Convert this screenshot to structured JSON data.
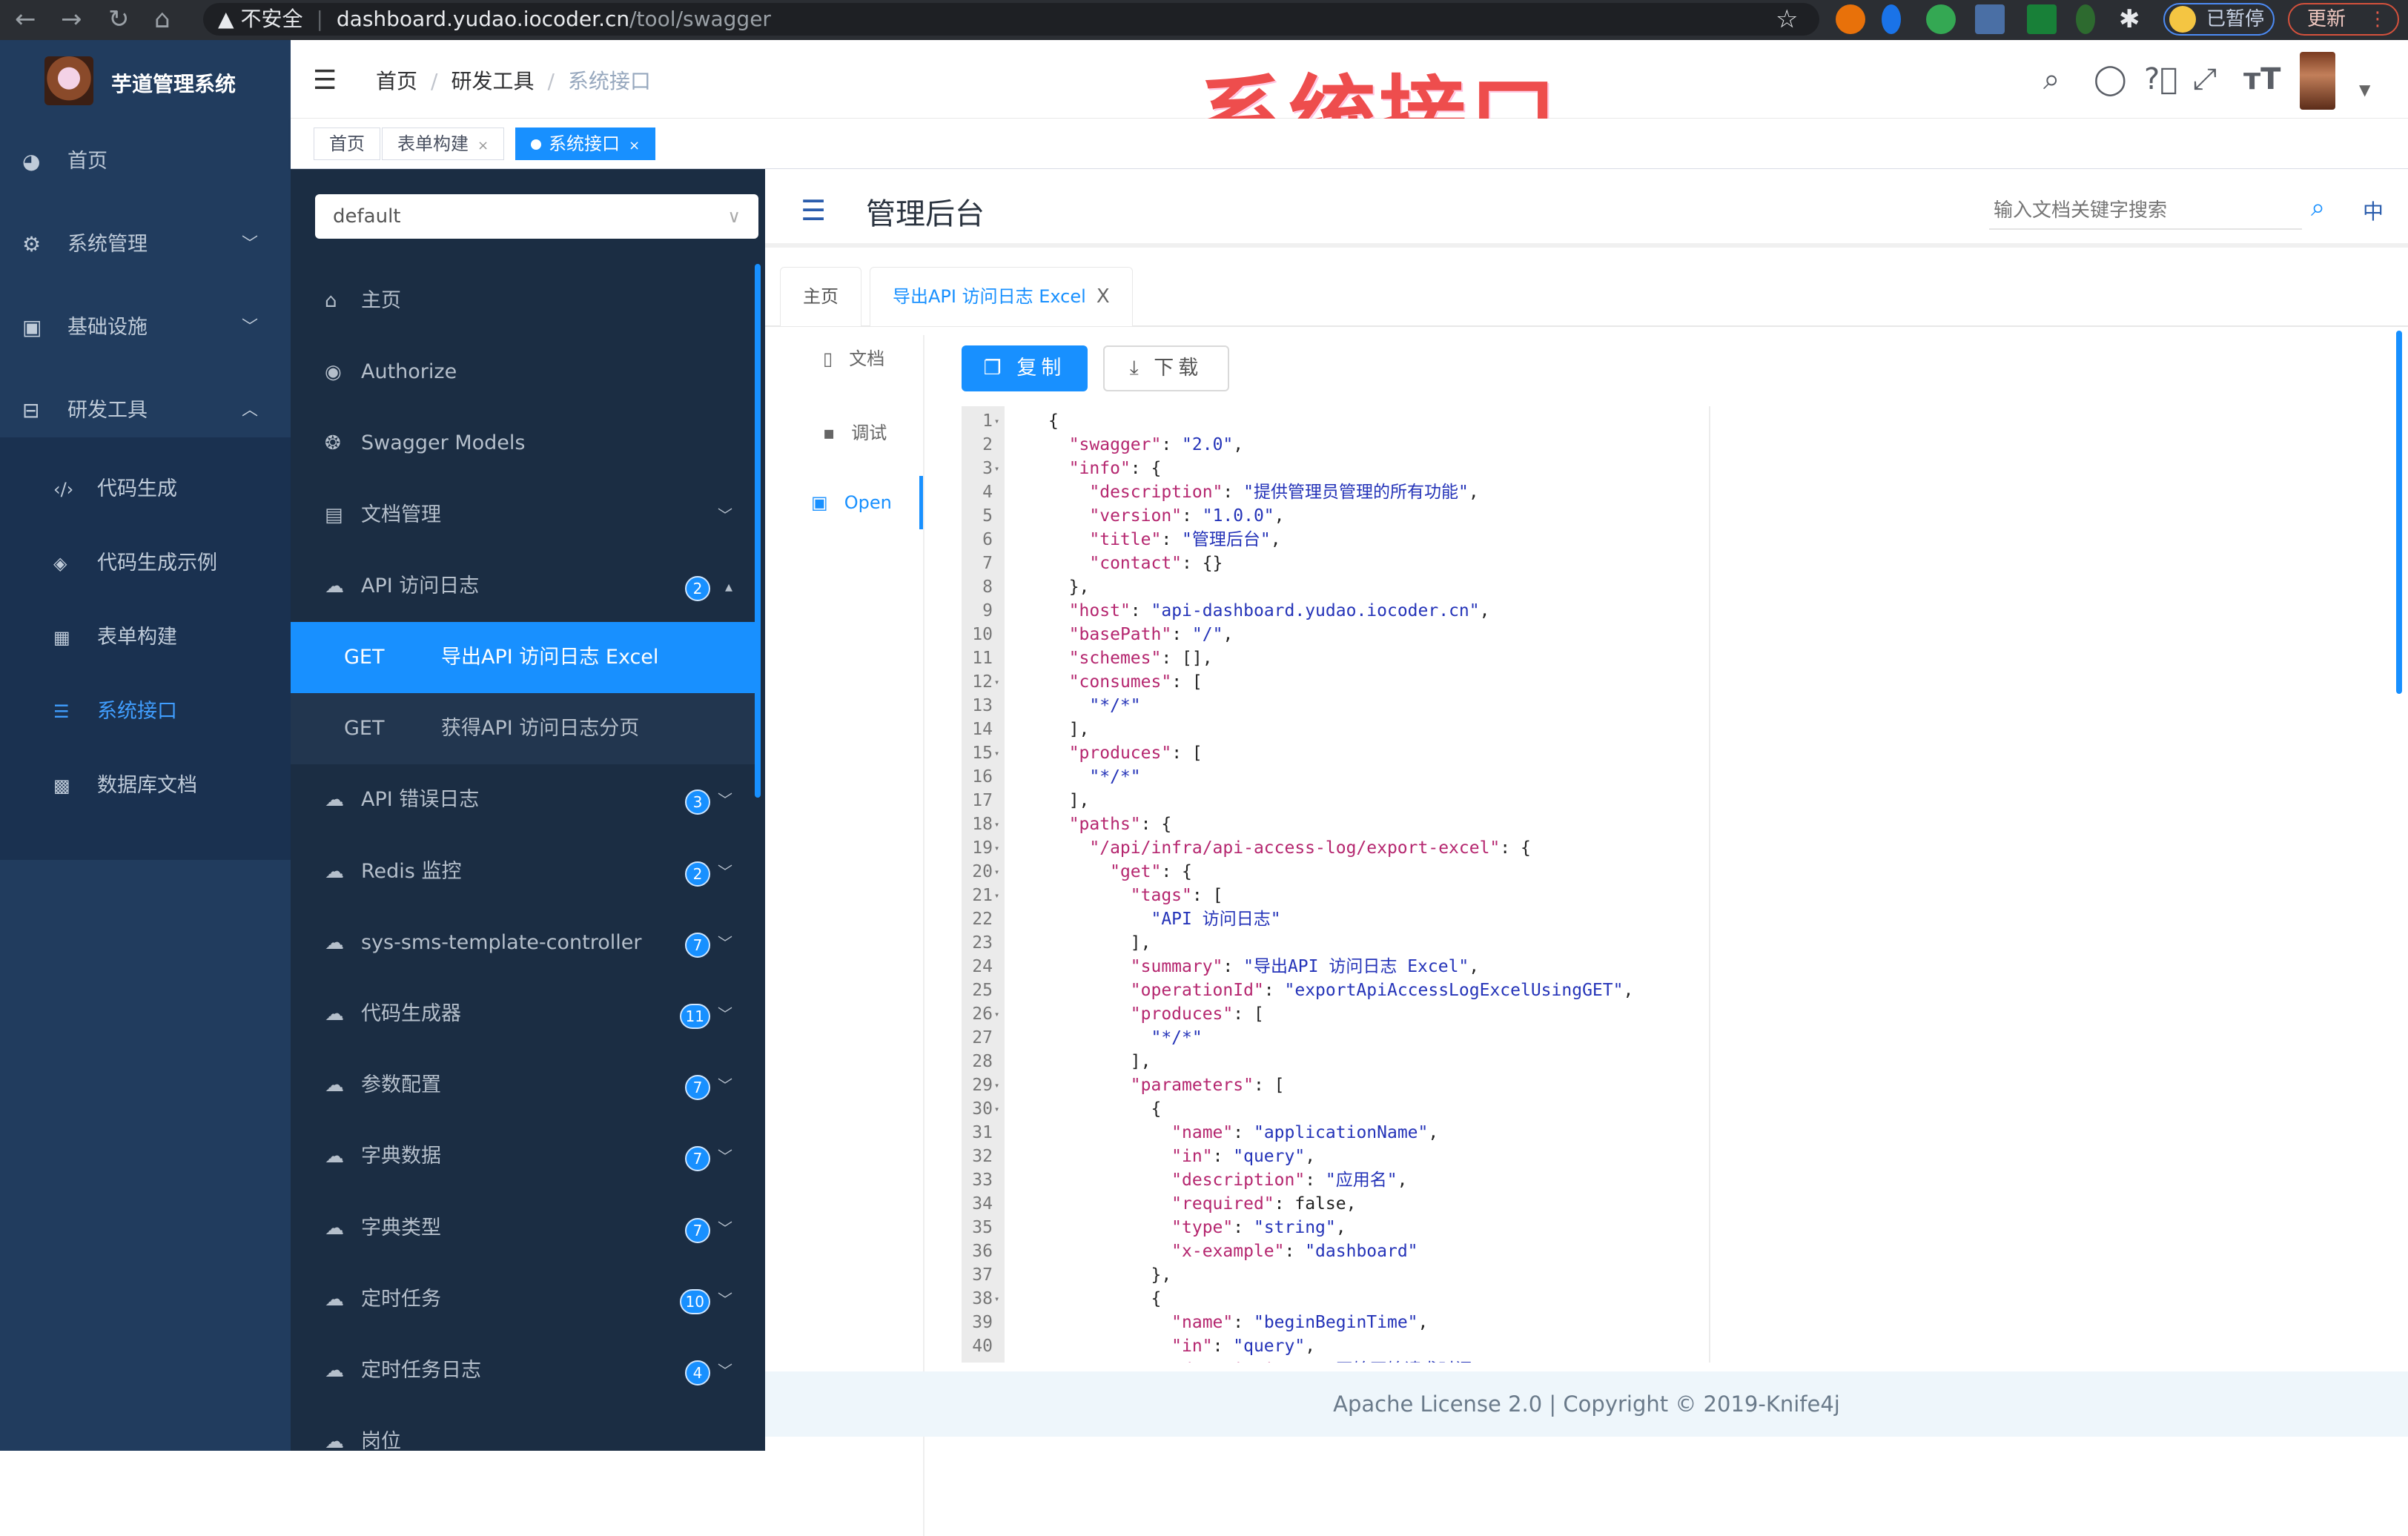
{
  "browser": {
    "insecure_label": "不安全",
    "url_host": "dashboard.yudao.iocoder.cn",
    "url_path": "/tool/swagger",
    "paused_label": "已暂停",
    "update_label": "更新"
  },
  "overlay_title": "系统接口",
  "sidebar": {
    "app_title": "芋道管理系统",
    "items": [
      {
        "label": "首页",
        "icon": "dashboard-icon",
        "glyph": "◕"
      },
      {
        "label": "系统管理",
        "icon": "gear-icon",
        "glyph": "⚙",
        "arrow": "﹀"
      },
      {
        "label": "基础设施",
        "icon": "monitor-icon",
        "glyph": "▣",
        "arrow": "﹀"
      },
      {
        "label": "研发工具",
        "icon": "toolbox-icon",
        "glyph": "⊟",
        "arrow": "︿"
      }
    ],
    "sub_items": [
      {
        "label": "代码生成",
        "icon": "code-icon",
        "glyph": "‹/›"
      },
      {
        "label": "代码生成示例",
        "icon": "shield-icon",
        "glyph": "◈"
      },
      {
        "label": "表单构建",
        "icon": "form-icon",
        "glyph": "▦"
      },
      {
        "label": "系统接口",
        "icon": "list-icon",
        "glyph": "☰",
        "active": true
      },
      {
        "label": "数据库文档",
        "icon": "table-icon",
        "glyph": "▩"
      }
    ]
  },
  "navbar": {
    "breadcrumb": [
      "首页",
      "研发工具",
      "系统接口"
    ],
    "icons": [
      "search-icon",
      "github-icon",
      "help-icon",
      "fullscreen-icon",
      "font-size-icon"
    ]
  },
  "tags": [
    {
      "label": "首页"
    },
    {
      "label": "表单构建",
      "close": "×"
    },
    {
      "label": "系统接口",
      "close": "×",
      "active": true
    }
  ],
  "knife4j": {
    "group_select": "default",
    "menu": [
      {
        "label": "主页",
        "glyph": "⌂",
        "icon": "home-icon"
      },
      {
        "label": "Authorize",
        "glyph": "◉",
        "icon": "lock-icon"
      },
      {
        "label": "Swagger Models",
        "glyph": "❂",
        "icon": "models-icon"
      },
      {
        "label": "文档管理",
        "glyph": "▤",
        "icon": "docs-icon",
        "arrow": "﹀"
      },
      {
        "label": "API 访问日志",
        "glyph": "☁",
        "icon": "cloud-icon",
        "badge": "2",
        "arrow": "▴"
      },
      {
        "method": "GET",
        "label": "导出API 访问日志 Excel",
        "active": true
      },
      {
        "method": "GET",
        "label": "获得API 访问日志分页"
      },
      {
        "label": "API 错误日志",
        "glyph": "☁",
        "icon": "cloud-icon",
        "badge": "3",
        "arrow": "﹀"
      },
      {
        "label": "Redis 监控",
        "glyph": "☁",
        "icon": "cloud-icon",
        "badge": "2",
        "arrow": "﹀"
      },
      {
        "label": "sys-sms-template-controller",
        "glyph": "☁",
        "icon": "cloud-icon",
        "badge": "7",
        "arrow": "﹀"
      },
      {
        "label": "代码生成器",
        "glyph": "☁",
        "icon": "cloud-icon",
        "badge": "11",
        "arrow": "﹀"
      },
      {
        "label": "参数配置",
        "glyph": "☁",
        "icon": "cloud-icon",
        "badge": "7",
        "arrow": "﹀"
      },
      {
        "label": "字典数据",
        "glyph": "☁",
        "icon": "cloud-icon",
        "badge": "7",
        "arrow": "﹀"
      },
      {
        "label": "字典类型",
        "glyph": "☁",
        "icon": "cloud-icon",
        "badge": "7",
        "arrow": "﹀"
      },
      {
        "label": "定时任务",
        "glyph": "☁",
        "icon": "cloud-icon",
        "badge": "10",
        "arrow": "﹀"
      },
      {
        "label": "定时任务日志",
        "glyph": "☁",
        "icon": "cloud-icon",
        "badge": "4",
        "arrow": "﹀"
      },
      {
        "label": "岗位",
        "glyph": "☁",
        "icon": "cloud-icon",
        "badge": "",
        "arrow": ""
      }
    ]
  },
  "doc": {
    "title": "管理后台",
    "search_placeholder": "输入文档关键字搜索",
    "lang": "中",
    "tabs": [
      {
        "label": "主页"
      },
      {
        "label": "导出API 访问日志 Excel",
        "close": "X",
        "active": true
      }
    ],
    "subnav": [
      {
        "label": "文档",
        "glyph": "▯",
        "icon": "document-icon"
      },
      {
        "label": "调试",
        "glyph": "▪",
        "icon": "debug-icon"
      },
      {
        "label": "Open",
        "glyph": "▣",
        "icon": "open-file-icon",
        "active": true
      }
    ],
    "copy_label": "复制",
    "download_label": "下载",
    "footer": "Apache License 2.0 | Copyright © 2019-Knife4j",
    "accent": "#1890ff"
  },
  "code": {
    "folds": [
      1,
      3,
      12,
      15,
      18,
      19,
      20,
      21,
      26,
      29,
      30,
      38
    ],
    "lines": [
      "{",
      "  \"swagger\": \"2.0\",",
      "  \"info\": {",
      "    \"description\": \"提供管理员管理的所有功能\",",
      "    \"version\": \"1.0.0\",",
      "    \"title\": \"管理后台\",",
      "    \"contact\": {}",
      "  },",
      "  \"host\": \"api-dashboard.yudao.iocoder.cn\",",
      "  \"basePath\": \"/\",",
      "  \"schemes\": [],",
      "  \"consumes\": [",
      "    \"*/*\"",
      "  ],",
      "  \"produces\": [",
      "    \"*/*\"",
      "  ],",
      "  \"paths\": {",
      "    \"/api/infra/api-access-log/export-excel\": {",
      "      \"get\": {",
      "        \"tags\": [",
      "          \"API 访问日志\"",
      "        ],",
      "        \"summary\": \"导出API 访问日志 Excel\",",
      "        \"operationId\": \"exportApiAccessLogExcelUsingGET\",",
      "        \"produces\": [",
      "          \"*/*\"",
      "        ],",
      "        \"parameters\": [",
      "          {",
      "            \"name\": \"applicationName\",",
      "            \"in\": \"query\",",
      "            \"description\": \"应用名\",",
      "            \"required\": false,",
      "            \"type\": \"string\",",
      "            \"x-example\": \"dashboard\"",
      "          },",
      "          {",
      "            \"name\": \"beginBeginTime\",",
      "            \"in\": \"query\",",
      "            \"description\": \"开始开始请求时间\""
    ]
  }
}
